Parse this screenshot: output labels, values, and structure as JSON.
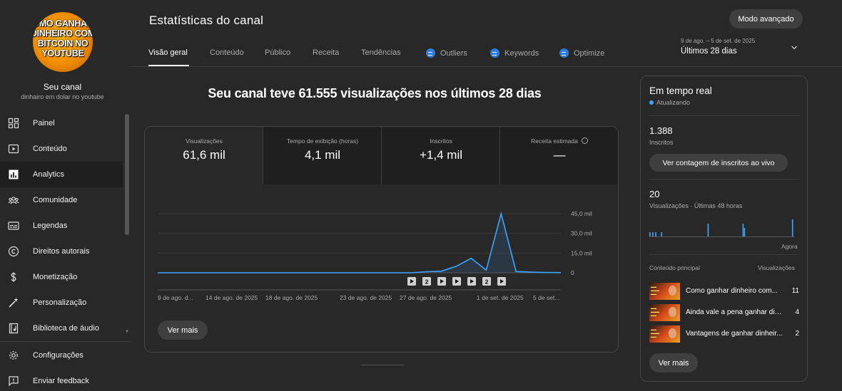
{
  "channel": {
    "avatar_lines": [
      "OMO GANHAR",
      "DINHEIRO COM",
      "BITCOIN NO",
      "YOUTUBE"
    ],
    "name": "Seu canal",
    "subtitle": "dinhairo em dolar no youtube"
  },
  "sidebar": {
    "items": [
      {
        "label": "Painel",
        "icon": "dashboard-icon"
      },
      {
        "label": "Conteúdo",
        "icon": "content-icon"
      },
      {
        "label": "Analytics",
        "icon": "analytics-icon",
        "active": true
      },
      {
        "label": "Comunidade",
        "icon": "community-icon"
      },
      {
        "label": "Legendas",
        "icon": "subtitles-icon"
      },
      {
        "label": "Direitos autorais",
        "icon": "copyright-icon"
      },
      {
        "label": "Monetização",
        "icon": "dollar-icon"
      },
      {
        "label": "Personalização",
        "icon": "magic-wand-icon"
      },
      {
        "label": "Biblioteca de áudio",
        "icon": "audio-library-icon"
      }
    ],
    "bottom": [
      {
        "label": "Configurações",
        "icon": "gear-icon"
      },
      {
        "label": "Enviar feedback",
        "icon": "feedback-icon"
      }
    ]
  },
  "header": {
    "title": "Estatísticas do canal",
    "advanced_button": "Modo avançado",
    "date_range": "9 de ago. – 5 de set. de 2025",
    "date_label": "Últimos 28 dias"
  },
  "tabs": [
    {
      "label": "Visão geral",
      "active": true
    },
    {
      "label": "Conteúdo"
    },
    {
      "label": "Público"
    },
    {
      "label": "Receita"
    },
    {
      "label": "Tendências"
    },
    {
      "label": "Outliers",
      "icon": "extension-icon"
    },
    {
      "label": "Keywords",
      "icon": "extension-icon"
    },
    {
      "label": "Optimize",
      "icon": "extension-icon"
    }
  ],
  "overview": {
    "headline": "Seu canal teve 61.555 visualizações nos últimos 28 dias",
    "metrics": [
      {
        "label": "Visualizações",
        "value": "61,6 mil",
        "selected": true
      },
      {
        "label": "Tempo de exibição (horas)",
        "value": "4,1 mil"
      },
      {
        "label": "Inscritos",
        "value": "+1,4 mil"
      },
      {
        "label": "Receita estimada",
        "value": "—",
        "icon": "clock-icon"
      }
    ],
    "more_button": "Ver mais"
  },
  "chart_data": {
    "type": "area",
    "x": [
      "9 ago",
      "10 ago",
      "11 ago",
      "12 ago",
      "13 ago",
      "14 ago",
      "15 ago",
      "16 ago",
      "17 ago",
      "18 ago",
      "19 ago",
      "20 ago",
      "21 ago",
      "22 ago",
      "23 ago",
      "24 ago",
      "25 ago",
      "26 ago",
      "27 ago",
      "28 ago",
      "29 ago",
      "30 ago",
      "31 ago",
      "1 set",
      "2 set",
      "3 set",
      "4 set",
      "5 set"
    ],
    "values": [
      0,
      0,
      0,
      0,
      0,
      0,
      0,
      0,
      0,
      0,
      0,
      0,
      0,
      0,
      0,
      0,
      0,
      0,
      800,
      1200,
      5000,
      11000,
      2000,
      45000,
      1000,
      500,
      200,
      100
    ],
    "series": [
      {
        "name": "Visualizações"
      }
    ],
    "xtick_labels": [
      "9 de ago. d...",
      "14 de ago. de 2025",
      "18 de ago. de 2025",
      "23 de ago. de 2025",
      "27 de ago. de 2025",
      "1 de set. de 2025",
      "5 de set..."
    ],
    "ytick_labels": [
      "45,0 mil",
      "30,0 mil",
      "15,0 mil",
      "0"
    ],
    "ylim": [
      0,
      45000
    ],
    "markers": [
      {
        "type": "video",
        "label": ""
      },
      {
        "type": "count",
        "label": "2"
      },
      {
        "type": "video",
        "label": ""
      },
      {
        "type": "video",
        "label": ""
      },
      {
        "type": "video",
        "label": ""
      },
      {
        "type": "count",
        "label": "2"
      },
      {
        "type": "video",
        "label": ""
      }
    ],
    "title": "",
    "xlabel": "",
    "ylabel": "",
    "grid": true,
    "color": "#3ea6ff"
  },
  "realtime": {
    "title": "Em tempo real",
    "status": "Atualizando",
    "subscribers_value": "1.388",
    "subscribers_label": "Inscritos",
    "subscribers_button": "Ver contagem de inscritos ao vivo",
    "views_value": "20",
    "views_label": "Visualizações · Últimas 48 horas",
    "sparkline": [
      1,
      0,
      1,
      0,
      1,
      0,
      0,
      0,
      1,
      0,
      0,
      0,
      0,
      0,
      0,
      0,
      0,
      0,
      0,
      0,
      0,
      0,
      0,
      0,
      0,
      0,
      0,
      0,
      0,
      0,
      0,
      0,
      0,
      0,
      0,
      0,
      0,
      0,
      0,
      0,
      3,
      0,
      0,
      0,
      0,
      0,
      0,
      0,
      0,
      0,
      0,
      0,
      0,
      0,
      0,
      0,
      0,
      0,
      0,
      0,
      0,
      0,
      0,
      0,
      3,
      2,
      0,
      0,
      0,
      0,
      0,
      0,
      0,
      0,
      0,
      0,
      0,
      0,
      0,
      0,
      0,
      0,
      0,
      0,
      0,
      0,
      0,
      0,
      0,
      0,
      0,
      0,
      0,
      0,
      0,
      0,
      0,
      0,
      4,
      0
    ],
    "now_label": "Agora",
    "top_content_label": "Conteúdo principal",
    "top_views_label": "Visualizações",
    "videos": [
      {
        "title": "Como ganhar dinheiro com...",
        "views": "11"
      },
      {
        "title": "Ainda vale a pena ganhar din...",
        "views": "4"
      },
      {
        "title": "Vantagens de ganhar dinheir...",
        "views": "2"
      }
    ],
    "more_button": "Ver mais"
  }
}
